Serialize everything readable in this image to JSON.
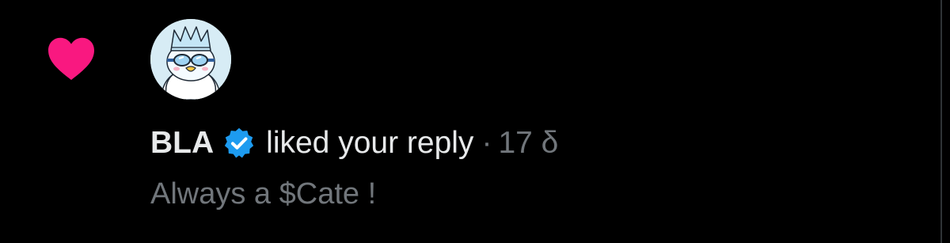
{
  "notification": {
    "icon": "heart-icon",
    "avatar": "penguin-crown-avatar",
    "user_name": "BLA",
    "verified_icon": "verified-badge-icon",
    "action": "liked your reply",
    "separator": "·",
    "timestamp": "17 δ",
    "reply_text": "Always a $Cate !"
  },
  "colors": {
    "heart": "#f91880",
    "verified": "#1d9bf0",
    "primary_text": "#e7e9ea",
    "secondary_text": "#71767b",
    "background": "#000000"
  }
}
